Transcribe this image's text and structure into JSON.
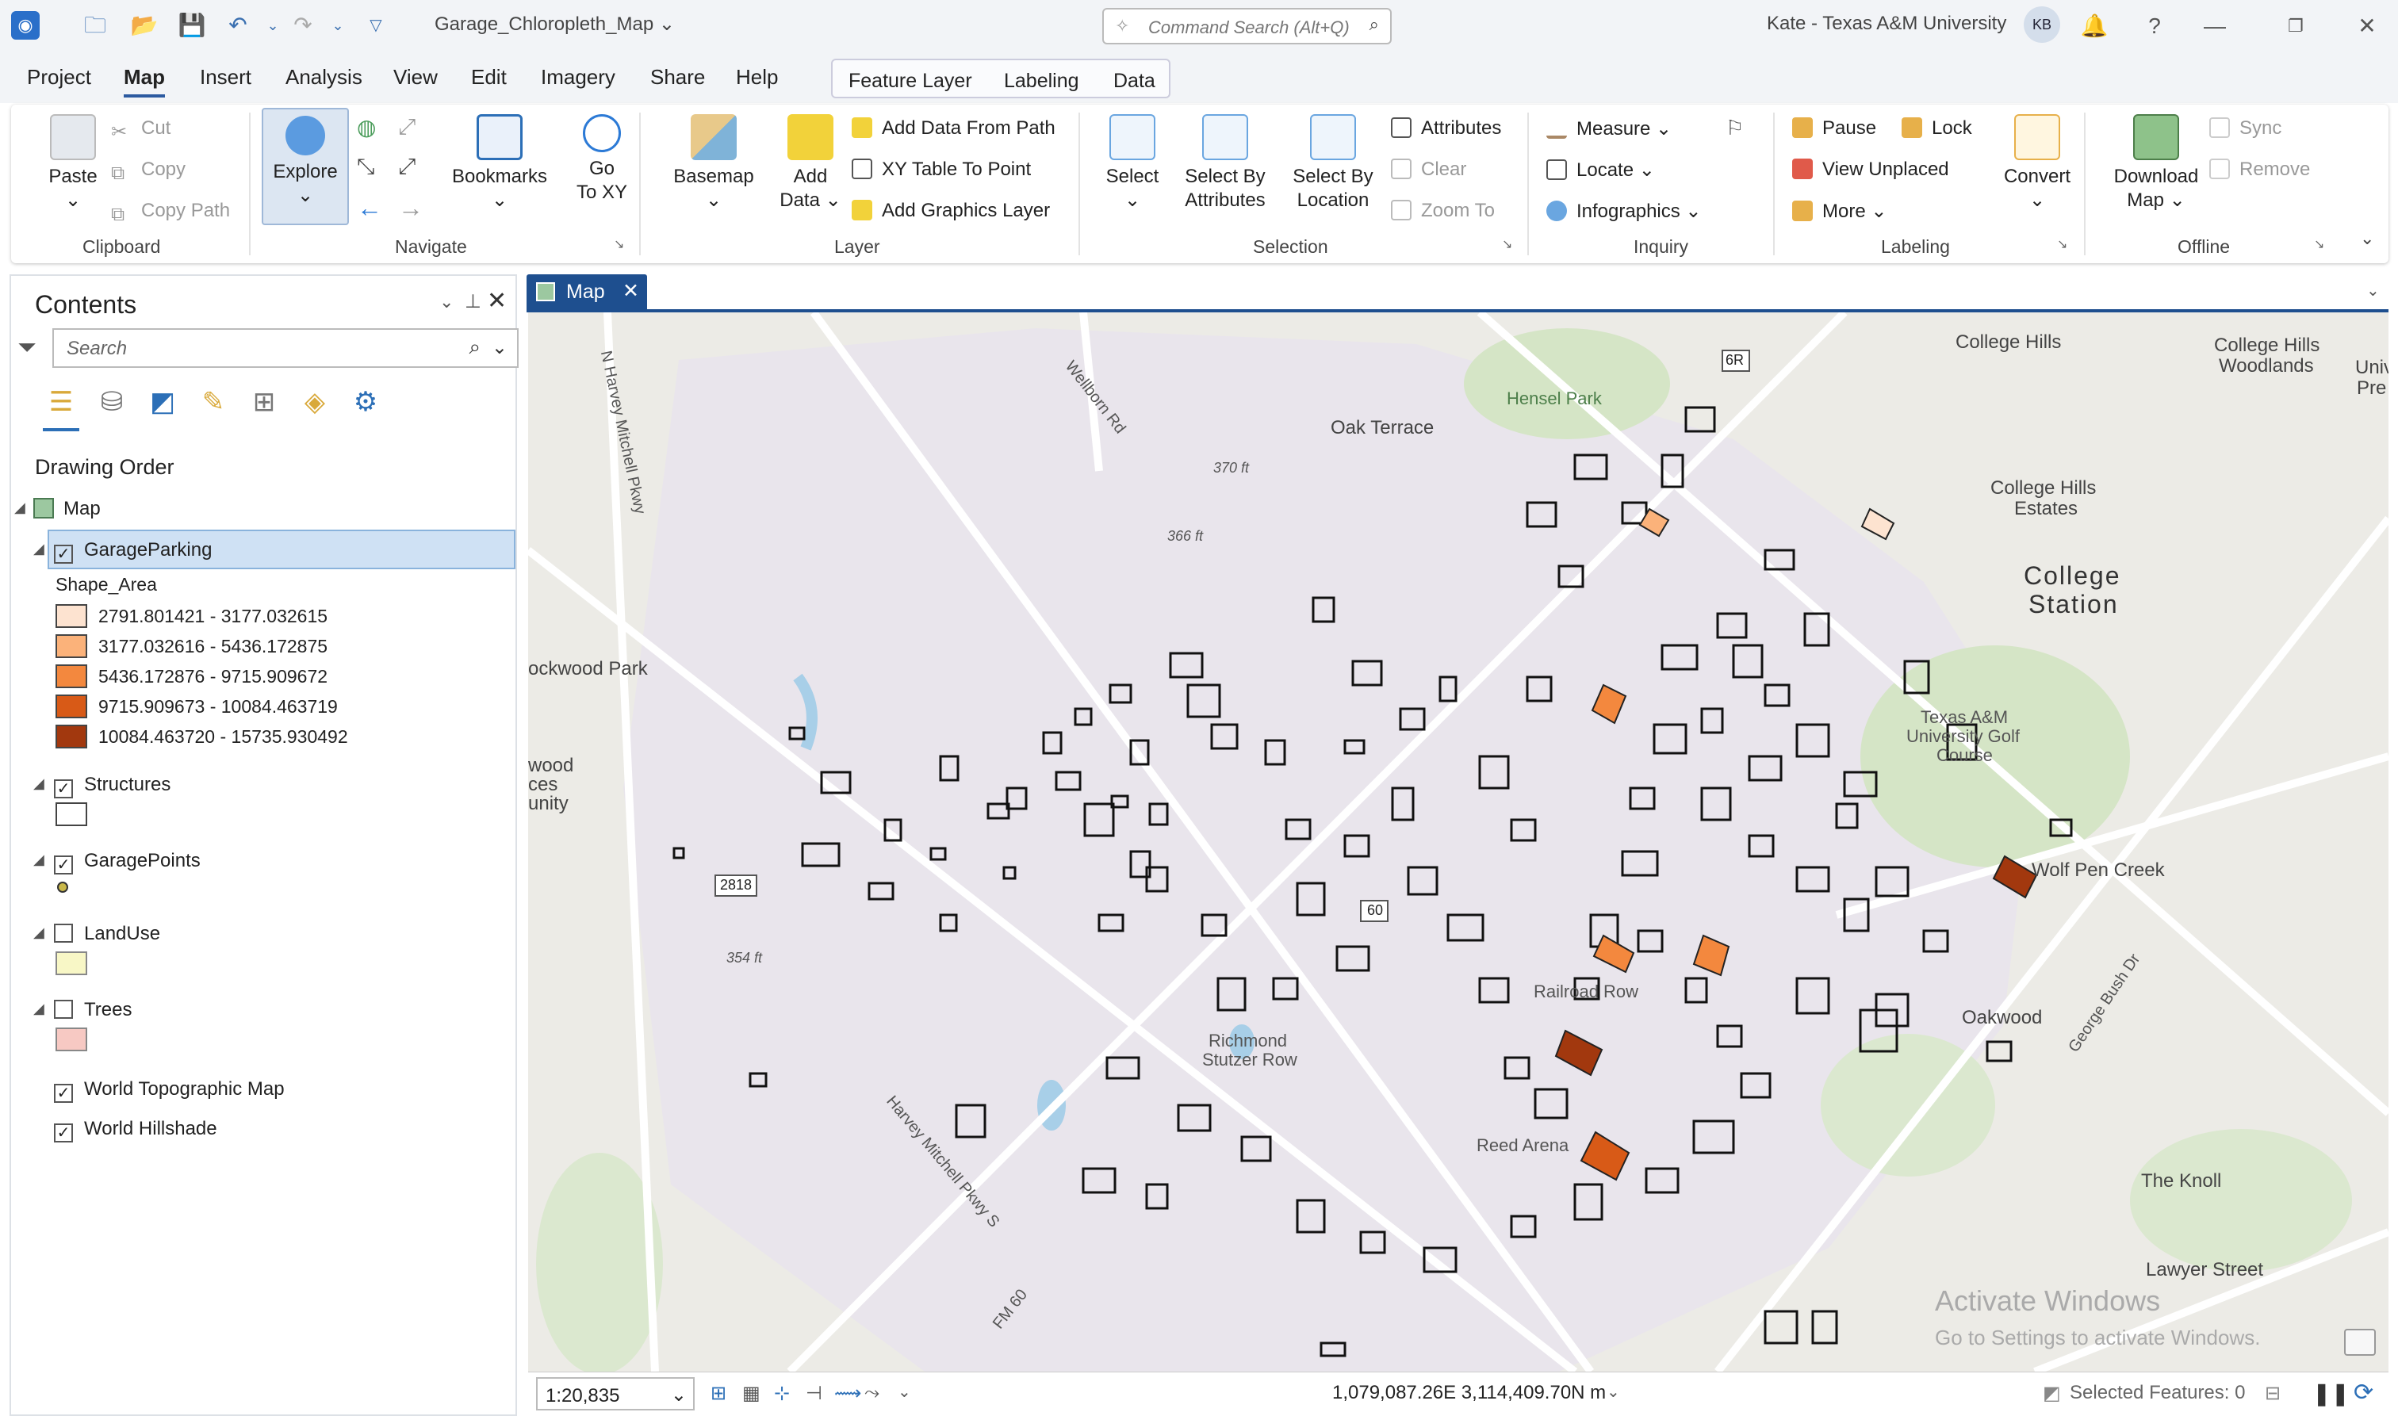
{
  "titlebar": {
    "doc_title": "Garage_Chloropleth_Map",
    "search_placeholder": "Command Search (Alt+Q)",
    "user": "Kate - Texas A&M University",
    "initials": "KB",
    "help": "?"
  },
  "menu": {
    "items": [
      "Project",
      "Map",
      "Insert",
      "Analysis",
      "View",
      "Edit",
      "Imagery",
      "Share",
      "Help"
    ],
    "contextual": [
      "Feature Layer",
      "Labeling",
      "Data"
    ]
  },
  "ribbon": {
    "clipboard": {
      "paste": "Paste",
      "cut": "Cut",
      "copy": "Copy",
      "copy_path": "Copy Path",
      "group": "Clipboard"
    },
    "navigate": {
      "explore": "Explore",
      "bookmarks": "Bookmarks",
      "go": "Go",
      "to_xy": "To XY",
      "group": "Navigate"
    },
    "layer": {
      "basemap": "Basemap",
      "add": "Add",
      "data": "Data",
      "add_data_from_path": "Add Data From Path",
      "xy_table": "XY Table To Point",
      "add_graphics": "Add Graphics Layer",
      "group": "Layer"
    },
    "selection": {
      "select": "Select",
      "select_by": "Select By",
      "attributes": "Attributes",
      "location": "Location",
      "attributes_btn": "Attributes",
      "clear": "Clear",
      "zoom_to": "Zoom To",
      "group": "Selection"
    },
    "inquiry": {
      "measure": "Measure",
      "locate": "Locate",
      "infographics": "Infographics",
      "group": "Inquiry"
    },
    "labeling": {
      "pause": "Pause",
      "lock": "Lock",
      "view_unplaced": "View Unplaced",
      "more": "More",
      "convert": "Convert",
      "group": "Labeling"
    },
    "offline": {
      "download": "Download",
      "map": "Map",
      "sync": "Sync",
      "remove": "Remove",
      "group": "Offline"
    }
  },
  "contents": {
    "title": "Contents",
    "search_placeholder": "Search",
    "drawing_order": "Drawing Order",
    "map_label": "Map",
    "layers": [
      {
        "name": "GarageParking",
        "checked": true,
        "selected": true
      },
      {
        "name": "Structures",
        "checked": true
      },
      {
        "name": "GaragePoints",
        "checked": true
      },
      {
        "name": "LandUse",
        "checked": false
      },
      {
        "name": "Trees",
        "checked": false
      },
      {
        "name": "World Topographic Map",
        "checked": true
      },
      {
        "name": "World Hillshade",
        "checked": true
      }
    ],
    "legend_field": "Shape_Area",
    "legend": [
      {
        "label": "2791.801421 - 3177.032615",
        "color": "#fde3d0"
      },
      {
        "label": "3177.032616 - 5436.172875",
        "color": "#fbb27a"
      },
      {
        "label": "5436.172876 - 9715.909672",
        "color": "#f3883e"
      },
      {
        "label": "9715.909673 - 10084.463719",
        "color": "#d85a17"
      },
      {
        "label": "10084.463720 - 15735.930492",
        "color": "#a2380e"
      }
    ],
    "structures_color": "#ffffff",
    "landuse_color": "#f8f7c6",
    "trees_color": "#f7c9c3"
  },
  "map_tab": {
    "label": "Map"
  },
  "map": {
    "labels": [
      {
        "text": "College Hills",
        "cls": "med"
      },
      {
        "text": "College Hills",
        "cls": "med"
      },
      {
        "text": "Woodlands",
        "cls": "med"
      },
      {
        "text": "Univ",
        "cls": "med"
      },
      {
        "text": "Pre",
        "cls": "med"
      },
      {
        "text": "Oak Terrace",
        "cls": "med"
      },
      {
        "text": "Hensel Park",
        "cls": ""
      },
      {
        "text": "College Hills",
        "cls": "med"
      },
      {
        "text": "Estates",
        "cls": "med"
      },
      {
        "text": "College",
        "cls": "big"
      },
      {
        "text": "Station",
        "cls": "big"
      },
      {
        "text": "ockwood Park",
        "cls": "med"
      },
      {
        "text": "Texas A&M",
        "cls": ""
      },
      {
        "text": "University Golf",
        "cls": ""
      },
      {
        "text": "Course",
        "cls": ""
      },
      {
        "text": "Wolf Pen Creek",
        "cls": "med"
      },
      {
        "text": "Oakwood",
        "cls": "med"
      },
      {
        "text": "Railroad Row",
        "cls": ""
      },
      {
        "text": "Reed Arena",
        "cls": ""
      },
      {
        "text": "Richmond",
        "cls": ""
      },
      {
        "text": "Stutzer Row",
        "cls": ""
      },
      {
        "text": "The Knoll",
        "cls": "med"
      },
      {
        "text": "Lawyer Street",
        "cls": "med"
      },
      {
        "text": "370 ft",
        "cls": ""
      },
      {
        "text": "366 ft",
        "cls": ""
      },
      {
        "text": "354 ft",
        "cls": ""
      },
      {
        "text": "2818",
        "cls": ""
      },
      {
        "text": "60",
        "cls": ""
      },
      {
        "text": "6R",
        "cls": ""
      },
      {
        "text": "Wellborn Rd",
        "cls": ""
      },
      {
        "text": "Harvey Mitchell Pkwy S",
        "cls": ""
      },
      {
        "text": "N Harvey Mitchell Pkwy",
        "cls": ""
      },
      {
        "text": "George Bush Dr",
        "cls": ""
      },
      {
        "text": "FM 60",
        "cls": ""
      },
      {
        "text": "wood",
        "cls": "med"
      },
      {
        "text": "ces",
        "cls": "med"
      },
      {
        "text": "unity",
        "cls": "med"
      }
    ],
    "watermark1": "Activate Windows",
    "watermark2": "Go to Settings to activate Windows."
  },
  "status": {
    "scale": "1:20,835",
    "coords": "1,079,087.26E 3,114,409.70N m",
    "selected": "Selected Features: 0"
  }
}
